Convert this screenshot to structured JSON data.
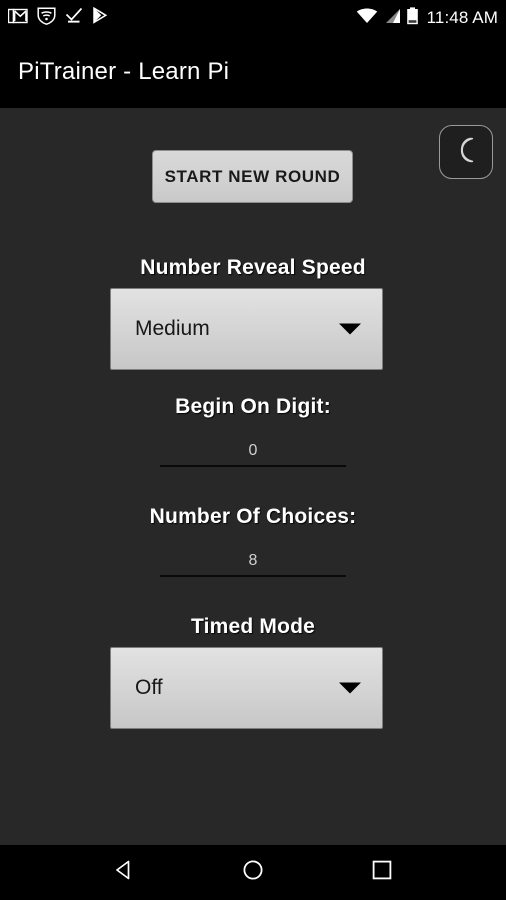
{
  "status_bar": {
    "icons_left": [
      "gmail-icon",
      "wifi-shield-icon",
      "checkmark-icon",
      "play-store-icon"
    ],
    "icons_right": [
      "wifi-icon",
      "cell-signal-icon",
      "battery-icon"
    ],
    "clock": "11:48 AM"
  },
  "action_bar": {
    "title": "PiTrainer - Learn Pi"
  },
  "main": {
    "night_mode_toggle": {
      "icon": "crescent-moon-icon",
      "label": ""
    },
    "start_round_button": "START NEW ROUND",
    "fields": {
      "reveal_speed": {
        "label": "Number Reveal Speed",
        "value": "Medium",
        "control": "spinner"
      },
      "begin_digit": {
        "label": "Begin On Digit:",
        "value": "0",
        "control": "number-input"
      },
      "num_choices": {
        "label": "Number Of Choices:",
        "value": "8",
        "control": "number-input"
      },
      "timed_mode": {
        "label": "Timed Mode",
        "value": "Off",
        "control": "spinner"
      }
    }
  },
  "nav_bar": {
    "back": "back-button",
    "home": "home-button",
    "recents": "recents-button"
  },
  "colors": {
    "window_background": "#282828",
    "bar_background": "#000000",
    "spinner_face": "#d6d6d6",
    "label_text": "#ffffff",
    "value_text": "#cfcfcf"
  }
}
